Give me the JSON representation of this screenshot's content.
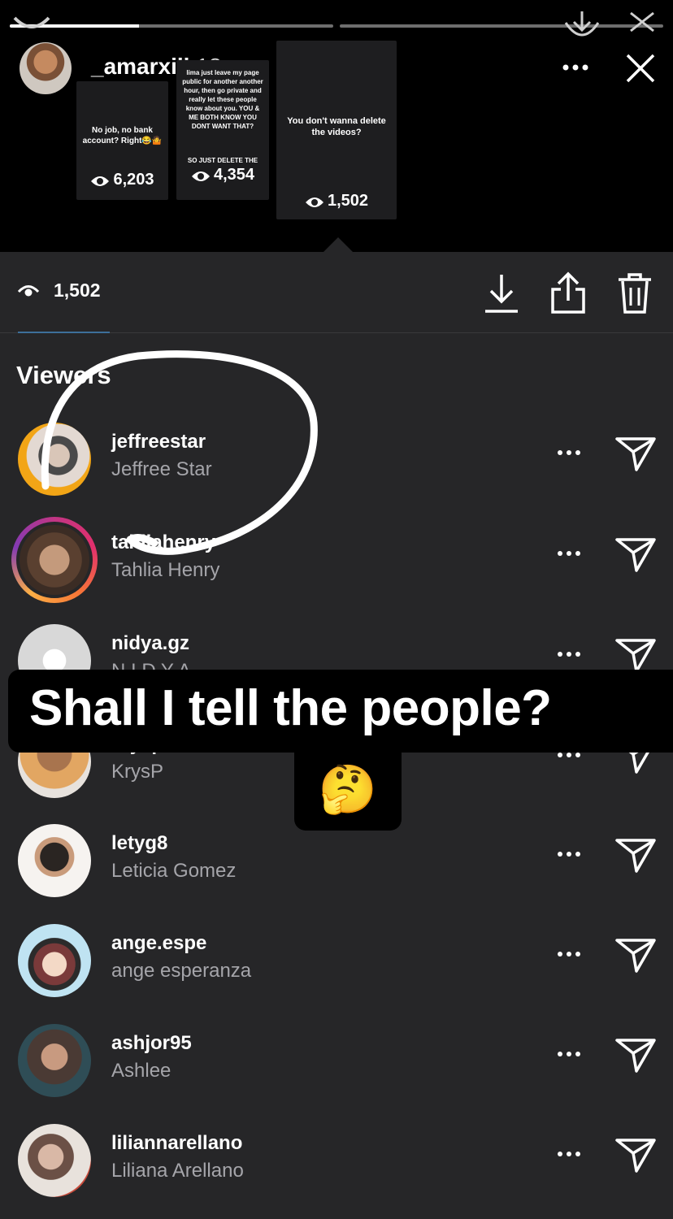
{
  "story": {
    "username": "_amarxiii",
    "time": "18m",
    "progress": [
      0.4,
      0.0
    ]
  },
  "thumbnails": [
    {
      "text": "No job, no bank account? Right😂🤷",
      "views": "6,203"
    },
    {
      "text": "lima just leave my page public for another another hour, then go private and really let these people know about you. YOU & ME BOTH KNOW YOU DONT WANT THAT?",
      "subtext": "SO JUST DELETE THE",
      "views": "4,354"
    },
    {
      "text": "You don't wanna delete the videos?",
      "views": "1,502"
    }
  ],
  "sheet": {
    "view_count": "1,502",
    "viewers_title": "Viewers"
  },
  "viewers": [
    {
      "username": "jeffreestar",
      "fullname": "Jeffree Star"
    },
    {
      "username": "tahliahenry",
      "fullname": "Tahlia Henry"
    },
    {
      "username": "nidya.gz",
      "fullname": "N I D Y A"
    },
    {
      "username": "krysp",
      "fullname": "KrysP"
    },
    {
      "username": "letyg8",
      "fullname": "Leticia Gomez"
    },
    {
      "username": "ange.espe",
      "fullname": "ange esperanza"
    },
    {
      "username": "ashjor95",
      "fullname": "Ashlee"
    },
    {
      "username": "liliannarellano",
      "fullname": "Liliana Arellano"
    }
  ],
  "overlay": {
    "caption": "Shall I tell the people?",
    "emoji": "🤔"
  },
  "colors": {
    "sheet_bg": "#262628",
    "accent": "#3d6f9a",
    "secondary_text": "#a5a5aa"
  }
}
